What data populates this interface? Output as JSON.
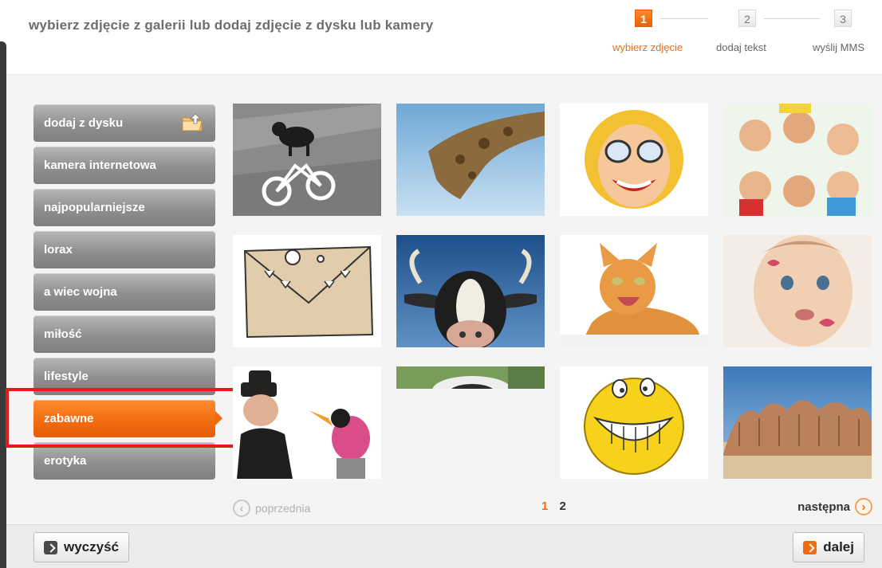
{
  "header": {
    "title": "wybierz zdjęcie z galerii lub dodaj zdjęcie z dysku lub kamery"
  },
  "steps": [
    {
      "number": "1",
      "label": "wybierz zdjęcie",
      "active": true
    },
    {
      "number": "2",
      "label": "dodaj tekst",
      "active": false
    },
    {
      "number": "3",
      "label": "wyślij MMS",
      "active": false
    }
  ],
  "sidebar": {
    "items": [
      {
        "label": "dodaj z dysku",
        "icon": "folder-upload-icon"
      },
      {
        "label": "kamera internetowa"
      },
      {
        "label": "najpopularniejsze"
      },
      {
        "label": "lorax"
      },
      {
        "label": "a wiec wojna"
      },
      {
        "label": "miłość"
      },
      {
        "label": "lifestyle"
      },
      {
        "label": "zabawne",
        "active": true
      },
      {
        "label": "erotyka"
      }
    ]
  },
  "gallery": {
    "images": [
      {
        "subject": "dog-on-bicycle-road-sign"
      },
      {
        "subject": "giraffe-head-sky"
      },
      {
        "subject": "cartoon-woman-glasses"
      },
      {
        "subject": "kids-circle-making-faces"
      },
      {
        "subject": "cartoon-envelope-face"
      },
      {
        "subject": "cow-head-sky"
      },
      {
        "subject": "laughing-kitten"
      },
      {
        "subject": "baby-lipstick-kisses"
      },
      {
        "subject": "man-with-puppet-bird"
      },
      {
        "subject": "cow-nose-grass"
      },
      {
        "subject": "smiley-big-teeth"
      },
      {
        "subject": "feet-on-beach"
      }
    ]
  },
  "pagination": {
    "prev_label": "poprzednia",
    "pages": [
      "1",
      "2"
    ],
    "current_page": "1",
    "next_label": "następna"
  },
  "actions": {
    "clear_label": "wyczyść",
    "next_label": "dalej"
  },
  "colors": {
    "accent": "#f06b10",
    "highlight": "#e51b1b",
    "sidebar_button": "#8f8f8f"
  }
}
